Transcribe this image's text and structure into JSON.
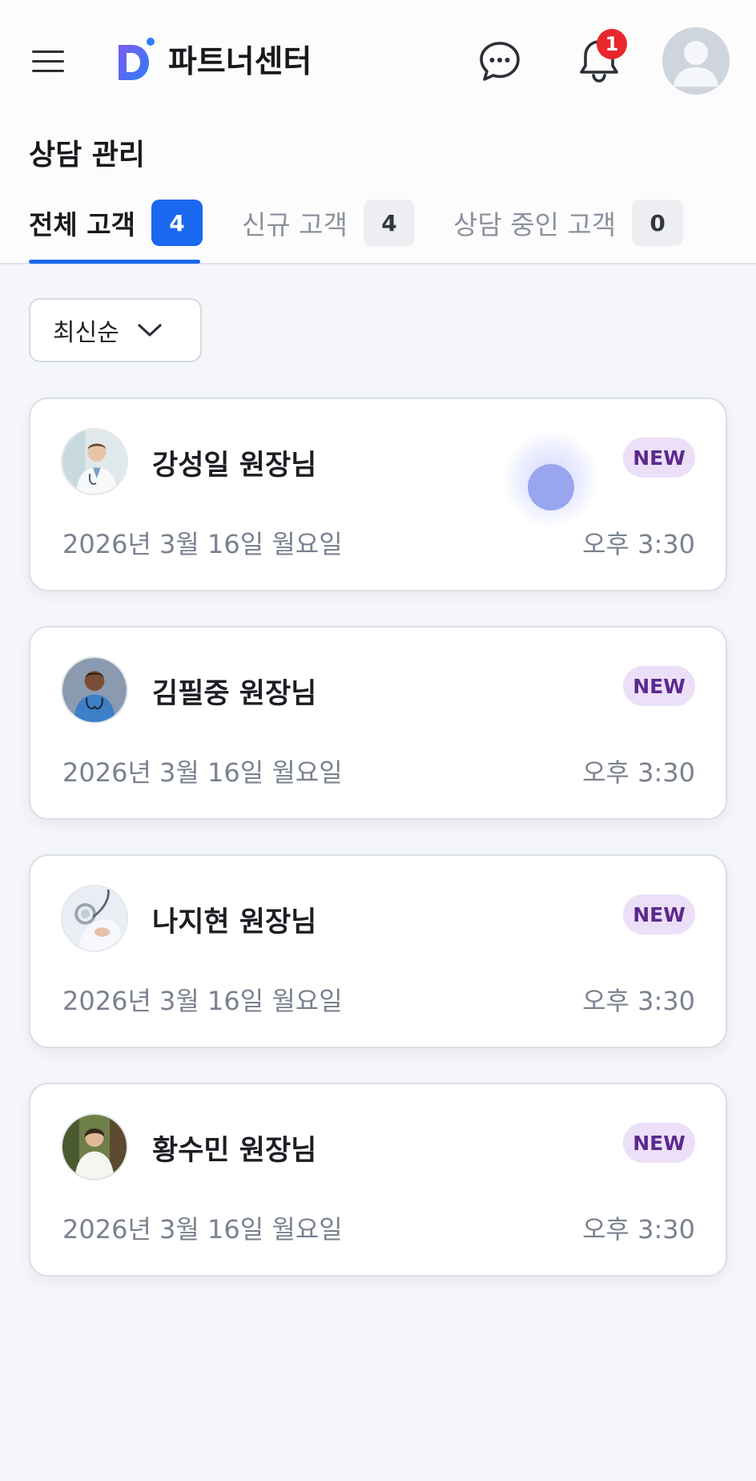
{
  "header": {
    "logo_text": "파트너센터",
    "notification_count": "1"
  },
  "page": {
    "title": "상담 관리"
  },
  "tabs": [
    {
      "label": "전체 고객",
      "count": "4",
      "active": true
    },
    {
      "label": "신규 고객",
      "count": "4",
      "active": false
    },
    {
      "label": "상담 중인 고객",
      "count": "0",
      "active": false
    }
  ],
  "sort": {
    "selected": "최신순"
  },
  "customers": [
    {
      "name": "강성일 원장님",
      "badge": "NEW",
      "date": "2026년 3월 16일 월요일",
      "time": "오후 3:30"
    },
    {
      "name": "김필중 원장님",
      "badge": "NEW",
      "date": "2026년 3월 16일 월요일",
      "time": "오후 3:30"
    },
    {
      "name": "나지현 원장님",
      "badge": "NEW",
      "date": "2026년 3월 16일 월요일",
      "time": "오후 3:30"
    },
    {
      "name": "황수민 원장님",
      "badge": "NEW",
      "date": "2026년 3월 16일 월요일",
      "time": "오후 3:30"
    }
  ],
  "colors": {
    "accent": "#1a67f0",
    "badge_bg": "#ecdff8",
    "badge_text": "#5b2a8c",
    "notification": "#e8262d"
  },
  "icons": {
    "menu": "hamburger-icon",
    "chat": "chat-bubble-icon",
    "notification": "bell-icon",
    "profile": "user-avatar-icon",
    "sort": "chevron-down-icon"
  }
}
